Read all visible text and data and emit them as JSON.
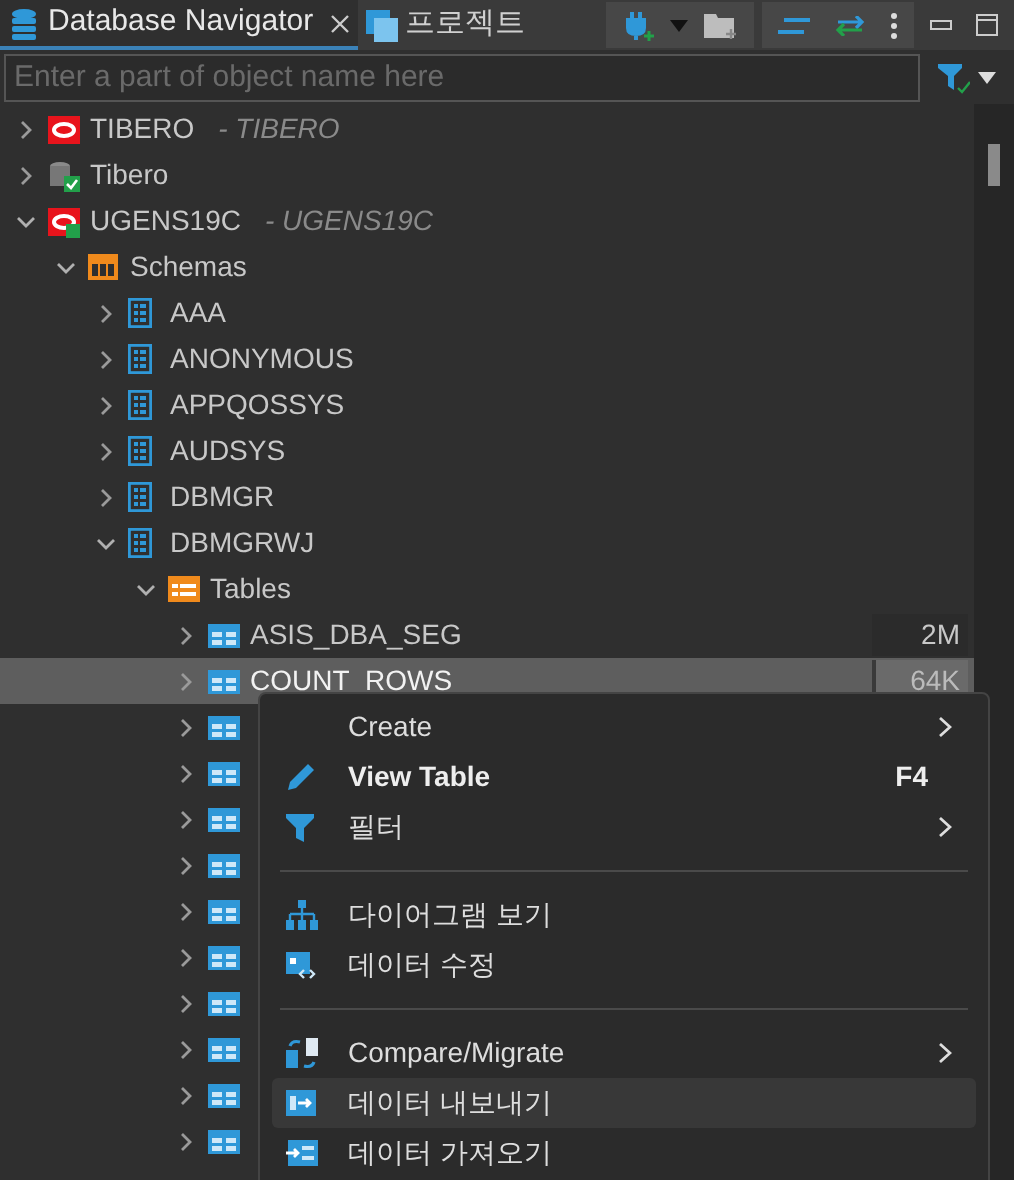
{
  "tabs": [
    {
      "label": "Database Navigator",
      "selected": true,
      "closable": true
    },
    {
      "label": "프로젝트",
      "selected": false,
      "closable": false
    }
  ],
  "filter": {
    "placeholder": "Enter a part of object name here"
  },
  "tree": [
    {
      "kind": "oracle",
      "label": "TIBERO",
      "suffix": "- TIBERO",
      "expanded": false,
      "selected": false
    },
    {
      "kind": "db",
      "label": "Tibero",
      "expanded": false,
      "selected": false
    },
    {
      "kind": "oracle-connected",
      "label": "UGENS19C",
      "suffix": "- UGENS19C",
      "expanded": true,
      "selected": false,
      "children": [
        {
          "kind": "schemas",
          "label": "Schemas",
          "expanded": true,
          "selected": false,
          "children": [
            {
              "kind": "schema",
              "label": "AAA",
              "expanded": false,
              "selected": false
            },
            {
              "kind": "schema",
              "label": "ANONYMOUS",
              "expanded": false,
              "selected": false
            },
            {
              "kind": "schema",
              "label": "APPQOSSYS",
              "expanded": false,
              "selected": false
            },
            {
              "kind": "schema",
              "label": "AUDSYS",
              "expanded": false,
              "selected": false
            },
            {
              "kind": "schema",
              "label": "DBMGR",
              "expanded": false,
              "selected": false
            },
            {
              "kind": "schema",
              "label": "DBMGRWJ",
              "expanded": true,
              "selected": false,
              "children": [
                {
                  "kind": "tables",
                  "label": "Tables",
                  "expanded": true,
                  "selected": false,
                  "children": [
                    {
                      "kind": "table",
                      "label": "ASIS_DBA_SEG",
                      "size": "2M",
                      "expanded": false,
                      "selected": false
                    },
                    {
                      "kind": "table",
                      "label": "COUNT_ROWS",
                      "size": "64K",
                      "expanded": false,
                      "selected": true
                    },
                    {
                      "kind": "table",
                      "expanded": false,
                      "selected": false
                    },
                    {
                      "kind": "table",
                      "expanded": false,
                      "selected": false
                    },
                    {
                      "kind": "table",
                      "expanded": false,
                      "selected": false
                    },
                    {
                      "kind": "table",
                      "expanded": false,
                      "selected": false
                    },
                    {
                      "kind": "table",
                      "expanded": false,
                      "selected": false
                    },
                    {
                      "kind": "table",
                      "expanded": false,
                      "selected": false
                    },
                    {
                      "kind": "table",
                      "expanded": false,
                      "selected": false
                    },
                    {
                      "kind": "table",
                      "expanded": false,
                      "selected": false
                    },
                    {
                      "kind": "table",
                      "expanded": false,
                      "selected": false
                    },
                    {
                      "kind": "table",
                      "expanded": false,
                      "selected": false
                    }
                  ]
                }
              ]
            }
          ]
        }
      ]
    }
  ],
  "menu": [
    {
      "kind": "item",
      "label": "Create",
      "submenu": true,
      "bold": false,
      "selected": false
    },
    {
      "kind": "item",
      "label": "View Table",
      "shortcut": "F4",
      "submenu": false,
      "bold": true,
      "selected": false
    },
    {
      "kind": "item",
      "label": "필터",
      "submenu": true,
      "bold": false,
      "selected": false
    },
    {
      "kind": "separator"
    },
    {
      "kind": "item",
      "label": "다이어그램 보기",
      "submenu": false,
      "bold": false,
      "selected": false
    },
    {
      "kind": "item",
      "label": "데이터 수정",
      "submenu": false,
      "bold": false,
      "selected": false
    },
    {
      "kind": "separator"
    },
    {
      "kind": "item",
      "label": "Compare/Migrate",
      "submenu": true,
      "bold": false,
      "selected": false
    },
    {
      "kind": "item",
      "label": "데이터 내보내기",
      "submenu": false,
      "bold": false,
      "selected": true
    },
    {
      "kind": "item",
      "label": "데이터 가져오기",
      "submenu": false,
      "bold": false,
      "selected": false
    }
  ]
}
